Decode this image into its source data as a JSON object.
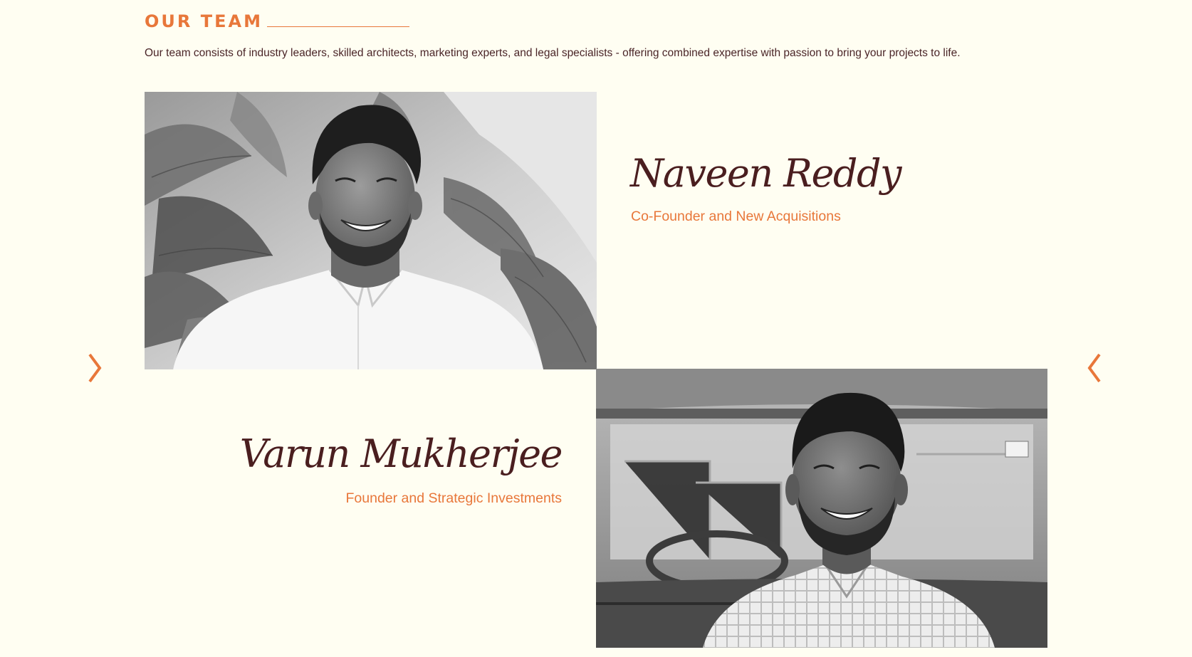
{
  "section": {
    "title": "OUR TEAM",
    "intro": "Our team consists of industry leaders, skilled architects, marketing experts, and legal specialists - offering combined expertise with passion to bring your projects to life."
  },
  "colors": {
    "background": "#fffef2",
    "accent": "#e8773a",
    "name": "#4a1e1f",
    "body_text": "#4a2528"
  },
  "team": [
    {
      "name": "Naveen Reddy",
      "role": "Co-Founder and New Acquisitions",
      "photo": "black-and-white portrait, smiling man in white shirt with tropical plants behind"
    },
    {
      "name": "Varun Mukherjee",
      "role": "Founder and Strategic Investments",
      "photo": "black-and-white portrait, smiling bearded man in checked shirt in front of a vehicle"
    }
  ],
  "carousel": {
    "prev_icon": "chevron-right-icon",
    "next_icon": "chevron-left-icon"
  }
}
